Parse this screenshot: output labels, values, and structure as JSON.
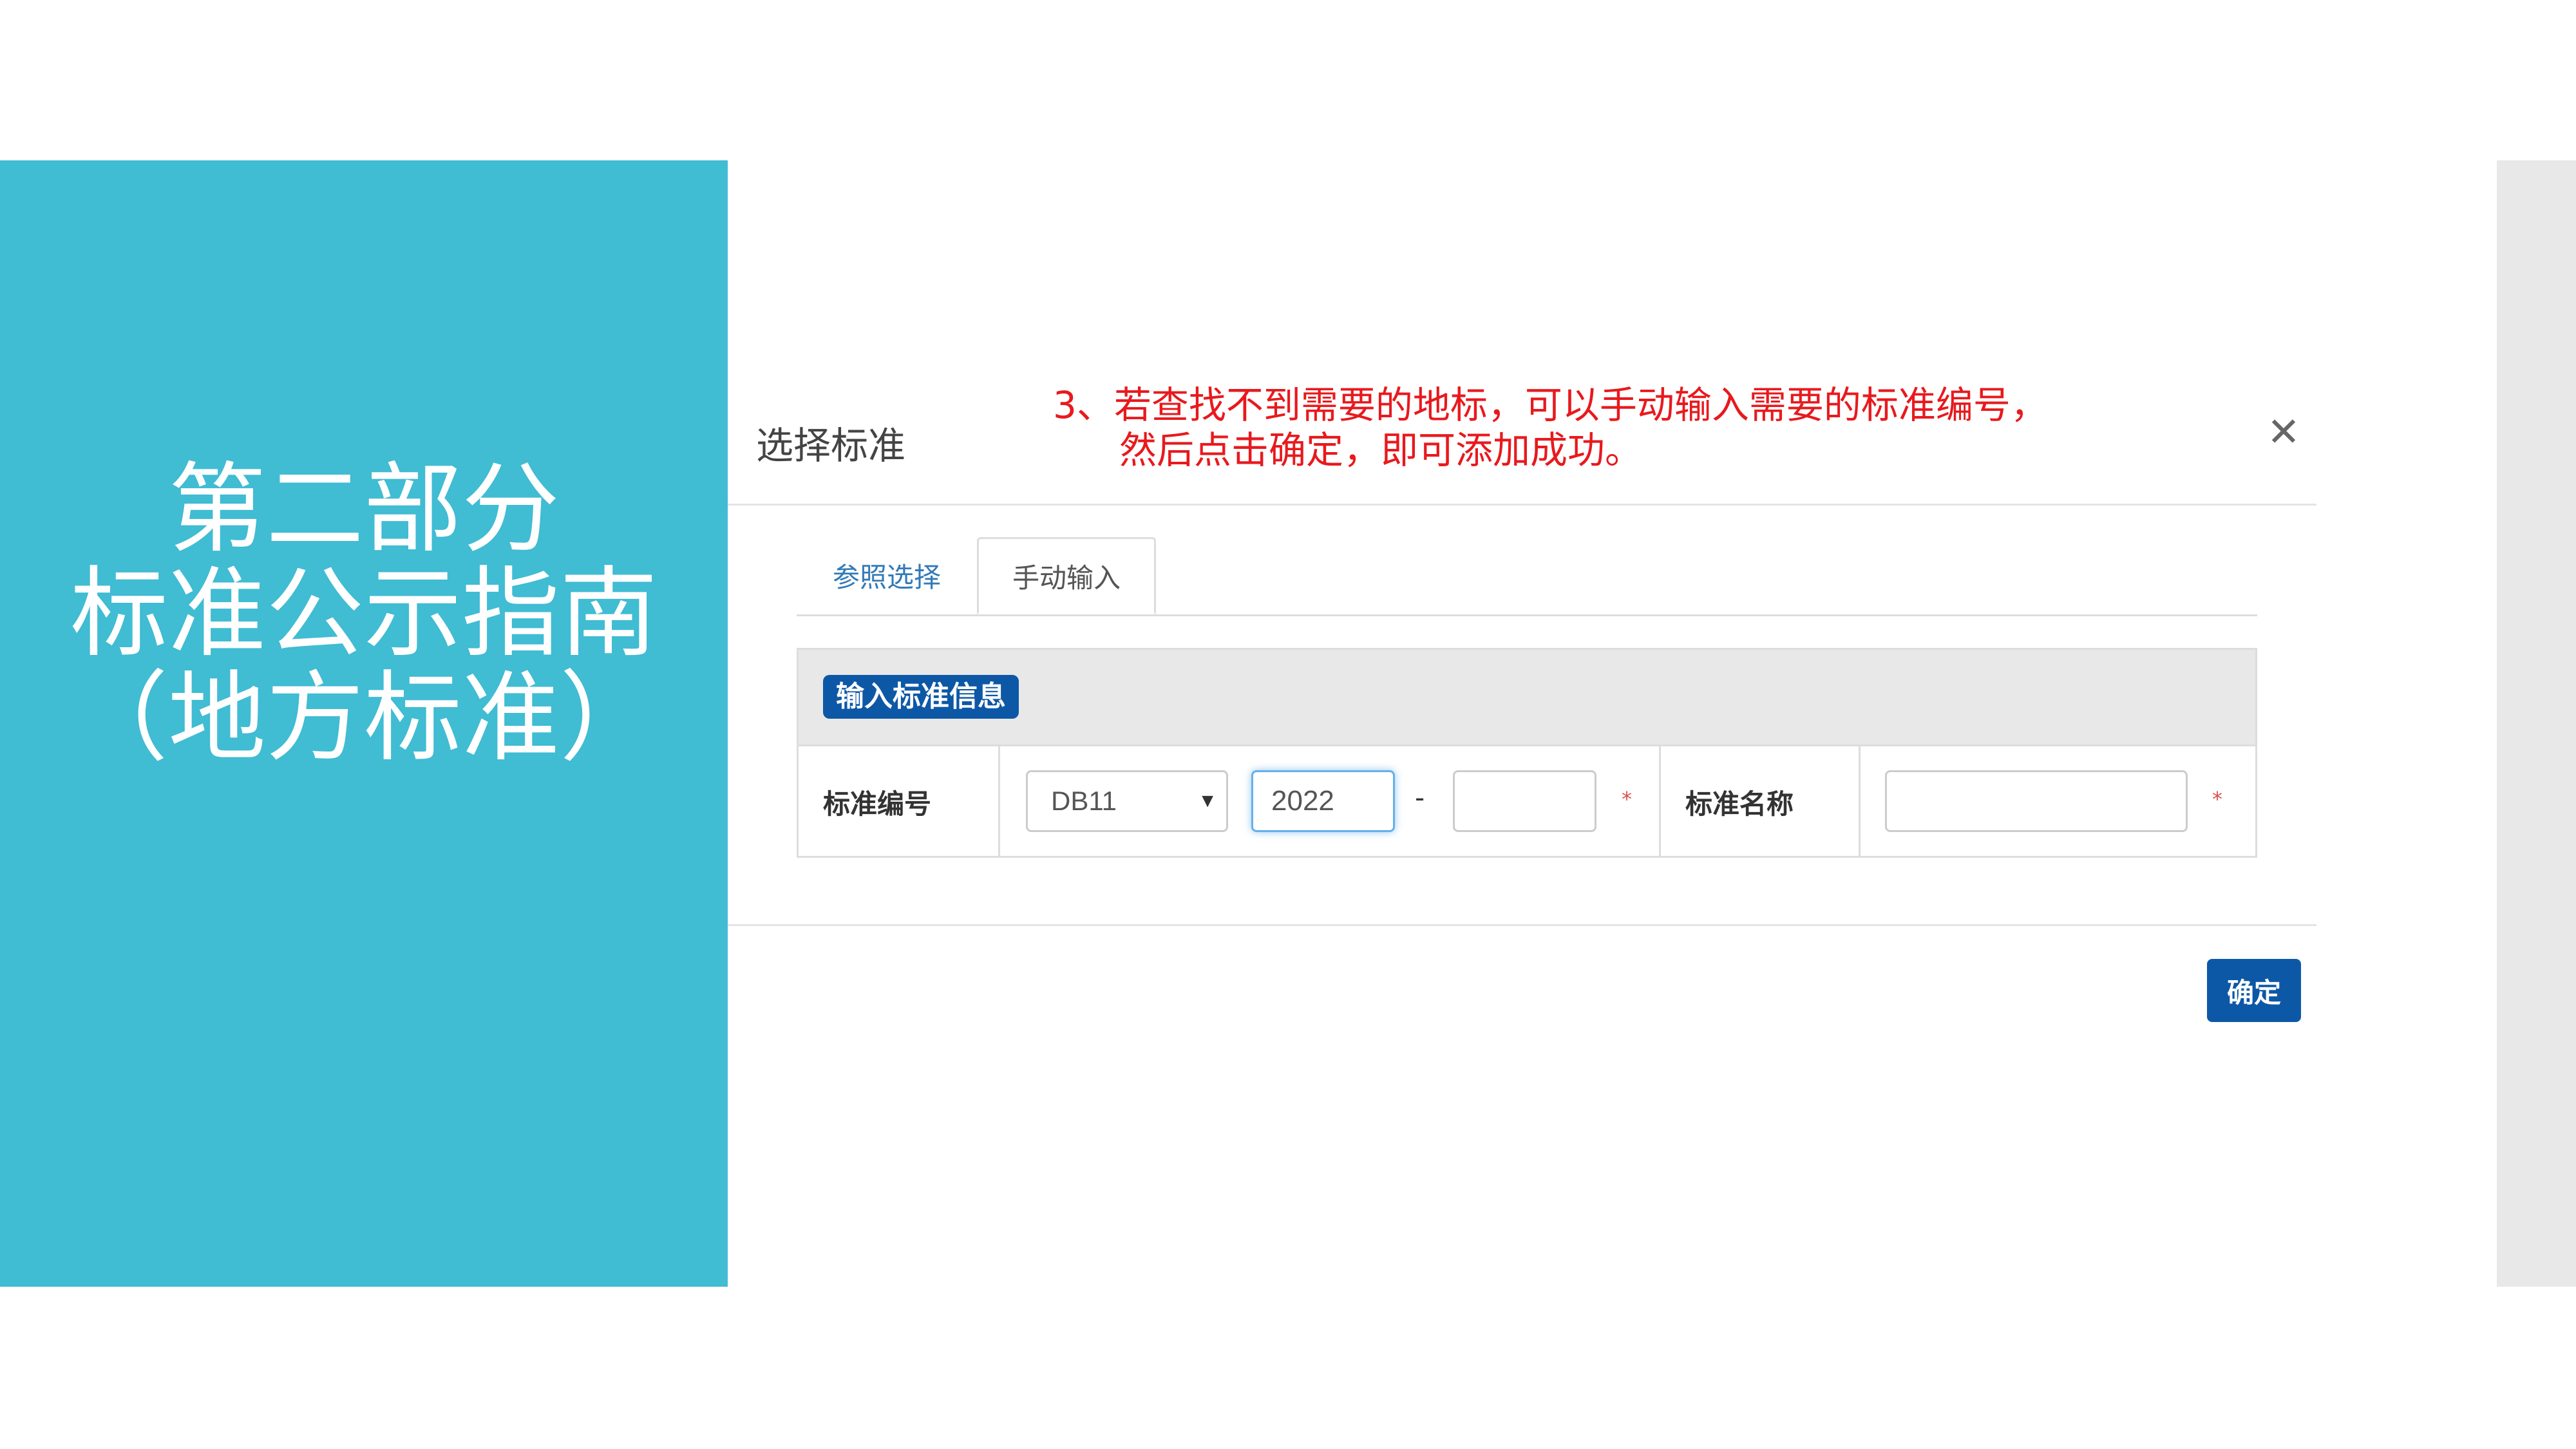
{
  "slide": {
    "section_title_lines": [
      "第二部分",
      "标准公示指南",
      "（地方标准）"
    ]
  },
  "dialog": {
    "title": "选择标准",
    "close_icon": "close-icon",
    "annotation_line1": "3、若查找不到需要的地标，可以手动输入需要的标准编号，",
    "annotation_line2": "然后点击确定，即可添加成功。",
    "tabs": [
      {
        "label": "参照选择",
        "active": false
      },
      {
        "label": "手动输入",
        "active": true
      }
    ],
    "form": {
      "header_badge": "输入标准信息",
      "code_label": "标准编号",
      "code_prefix_selected": "DB11",
      "code_year_value": "2022",
      "code_sequence_value": "",
      "dash": "-",
      "required_mark": "*",
      "name_label": "标准名称",
      "name_value": ""
    },
    "confirm_label": "确定"
  },
  "colors": {
    "panel_teal": "#40bcd3",
    "annotation_red": "#e8191d",
    "primary_blue": "#0d58a6",
    "link_blue": "#337ab7"
  }
}
